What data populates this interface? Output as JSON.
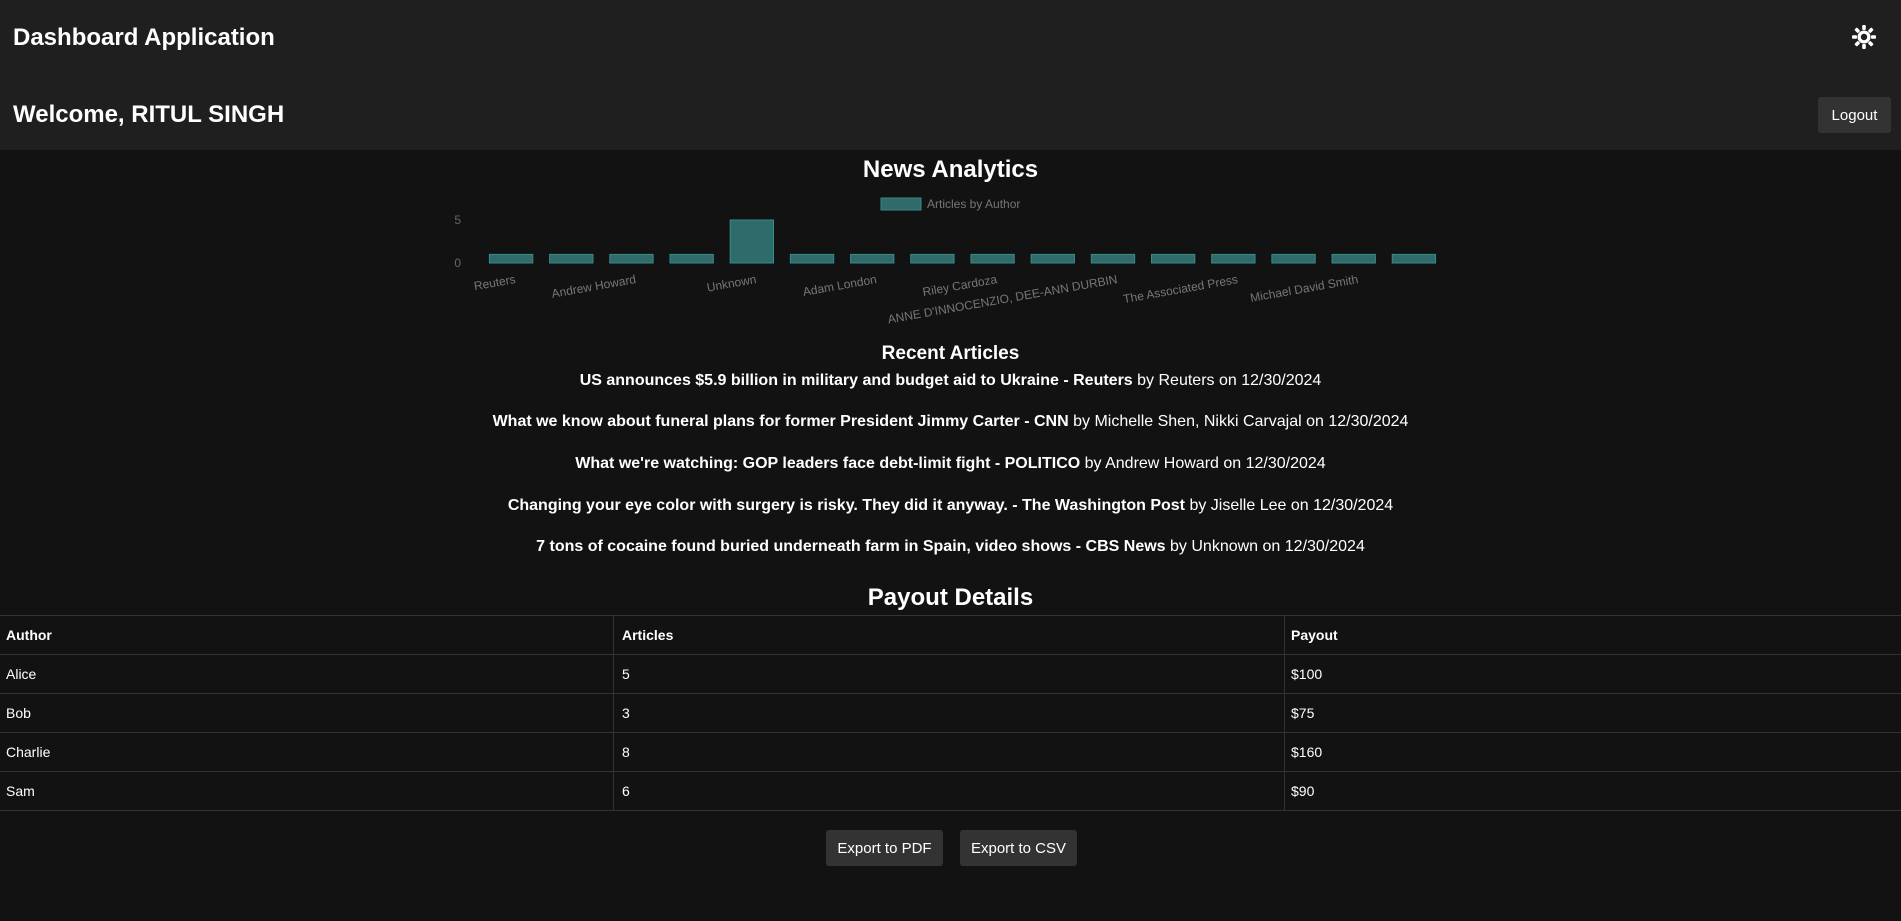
{
  "header": {
    "app_title": "Dashboard Application",
    "theme_icon": "sun-icon",
    "welcome": "Welcome, RITUL SINGH",
    "logout_label": "Logout"
  },
  "analytics": {
    "title": "News Analytics"
  },
  "chart_data": {
    "type": "bar",
    "legend": "Articles by Author",
    "bar_color": "#3a8a8a",
    "categories": [
      "Reuters",
      "",
      "Andrew Howard",
      "",
      "Unknown",
      "",
      "Adam London",
      "",
      "Riley Cardoza",
      "",
      "ANNE D'INNOCENZIO, DEE-ANN DURBIN",
      "",
      "The Associated Press",
      "",
      "Michael David Smith",
      ""
    ],
    "values": [
      1,
      1,
      1,
      1,
      5,
      1,
      1,
      1,
      1,
      1,
      1,
      1,
      1,
      1,
      1,
      1
    ],
    "yticks": [
      "0",
      "5"
    ],
    "ylim": [
      0,
      5
    ]
  },
  "recent": {
    "title": "Recent Articles",
    "articles": [
      {
        "title": "US announces $5.9 billion in military and budget aid to Ukraine - Reuters",
        "by": "by Reuters on 12/30/2024"
      },
      {
        "title": "What we know about funeral plans for former President Jimmy Carter - CNN",
        "by": "by Michelle Shen, Nikki Carvajal on 12/30/2024"
      },
      {
        "title": "What we're watching: GOP leaders face debt-limit fight - POLITICO",
        "by": "by Andrew Howard on 12/30/2024"
      },
      {
        "title": "Changing your eye color with surgery is risky. They did it anyway. - The Washington Post",
        "by": "by Jiselle Lee on 12/30/2024"
      },
      {
        "title": "7 tons of cocaine found buried underneath farm in Spain, video shows - CBS News",
        "by": "by Unknown on 12/30/2024"
      }
    ]
  },
  "payout": {
    "title": "Payout Details",
    "headers": [
      "Author",
      "Articles",
      "Payout"
    ],
    "rows": [
      [
        "Alice",
        "5",
        "$100"
      ],
      [
        "Bob",
        "3",
        "$75"
      ],
      [
        "Charlie",
        "8",
        "$160"
      ],
      [
        "Sam",
        "6",
        "$90"
      ]
    ]
  },
  "export": {
    "pdf_label": "Export to PDF",
    "csv_label": "Export to CSV"
  }
}
